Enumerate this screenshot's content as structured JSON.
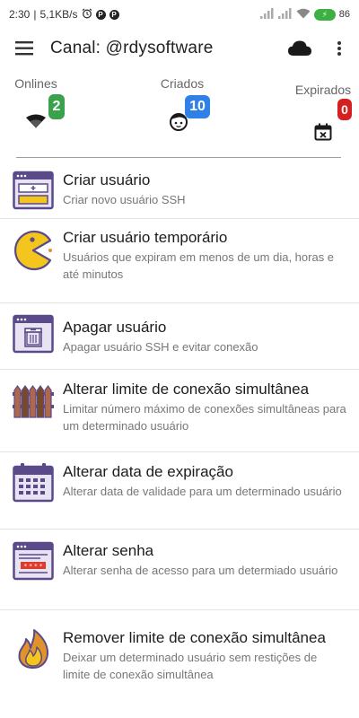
{
  "status_bar": {
    "time": "2:30",
    "net_speed": "5,1KB/s",
    "p1": "P",
    "p2": "P",
    "battery_level": "86"
  },
  "app_bar": {
    "title": "Canal: @rdysoftware",
    "menu_icon": "hamburger-menu-icon",
    "cloud_icon": "cloud-icon",
    "more_icon": "more-vert-icon"
  },
  "stats": {
    "onlines": {
      "label": "Onlines",
      "count": "2",
      "color": "#3aa24b",
      "icon": "wifi-icon"
    },
    "criados": {
      "label": "Criados",
      "count": "10",
      "color": "#2f80e8",
      "icon": "user-face-icon"
    },
    "expirados": {
      "label": "Expirados",
      "count": "0",
      "color": "#d62020",
      "icon": "calendar-x-icon"
    }
  },
  "menu": [
    {
      "title": "Criar usuário",
      "desc": "Criar novo usuário SSH",
      "icon": "create-user-window-icon"
    },
    {
      "title": "Criar usuário temporário",
      "desc": "Usuários que expiram em menos de um dia, horas e até minutos",
      "icon": "pacman-icon"
    },
    {
      "title": "Apagar usuário",
      "desc": "Apagar usuário SSH e evitar conexão",
      "icon": "trash-window-icon"
    },
    {
      "title": "Alterar limite de conexão simultânea",
      "desc": "Limitar número máximo de conexões simultâneas para um determinado usuário",
      "icon": "fence-icon"
    },
    {
      "title": "Alterar data de expiração",
      "desc": "Alterar data de validade para um determinado usuário",
      "icon": "calendar-icon"
    },
    {
      "title": "Alterar senha",
      "desc": "Alterar senha de acesso para um determiado usuário",
      "icon": "password-window-icon"
    },
    {
      "title": "Remover limite de conexão simultânea",
      "desc": "Deixar um determinado usuário sem restições de limite de conexão simultânea",
      "icon": "fire-icon"
    }
  ],
  "colors": {
    "purple": "#5b4a8a",
    "yellow": "#f4c51c",
    "orange": "#e2922a",
    "brown": "#7a4a26",
    "red": "#e03a2a"
  }
}
